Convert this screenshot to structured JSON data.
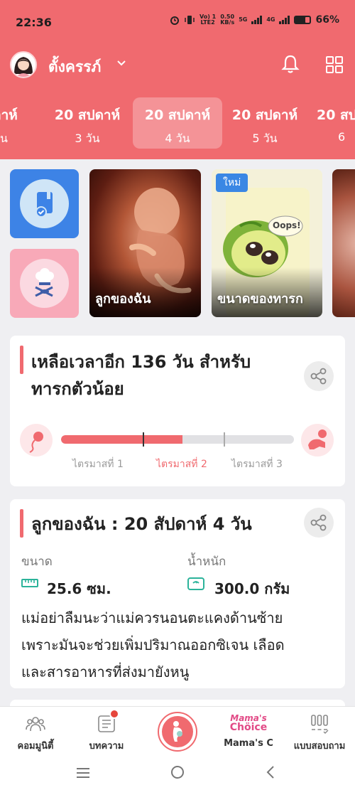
{
  "status_bar": {
    "time": "22:36",
    "net_line1": "Vo) 1",
    "net_line2": "LTE2",
    "speed_line1": "0.50",
    "speed_line2": "KB/s",
    "net_5g": "5G",
    "net_4g": "4G",
    "battery": "66%"
  },
  "header": {
    "username": "ตั้งครรภ์",
    "weeks": [
      {
        "week": "ปดาห์",
        "days": "วัน"
      },
      {
        "week": "20 สปดาห์",
        "days": "3 วัน"
      },
      {
        "week": "20 สปดาห์",
        "days": "4 วัน"
      },
      {
        "week": "20 สปดาห์",
        "days": "5 วัน"
      },
      {
        "week": "20 สป",
        "days": "6"
      }
    ]
  },
  "tiles": {
    "card_fetus_label": "ลูกของฉัน",
    "card_size_label": "ขนาดของทารก",
    "card_size_badge": "ใหม่",
    "oops_text": "Oops!"
  },
  "countdown": {
    "title_line1": "เหลือเวลาอีก 136 วัน สำหรับ",
    "title_line2": "ทารกตัวน้อย",
    "progress": 0.52,
    "trimesters": [
      "ไตรมาสที่ 1",
      "ไตรมาสที่ 2",
      "ไตรมาสที่ 3"
    ],
    "active_trimester": 2
  },
  "baby": {
    "title": "ลูกของฉัน : 20 สัปดาห์ 4  วัน",
    "size_label": "ขนาด",
    "size_value": "25.6 ซม.",
    "weight_label": "น้ำหนัก",
    "weight_value": "300.0 กรัม",
    "body_line1": "แม่อย่าลืมนะว่าแม่ควรนอนตะแคงด้านซ้าย",
    "body_line2": "เพราะมันจะช่วยเพิ่มปริมาณออกซิเจน เลือด",
    "body_line3": "และสารอาหารที่ส่งมายังหนู"
  },
  "bottom_nav": {
    "community": "คอมมูนิตี้",
    "articles": "บทความ",
    "mamas_logo_1": "Mama's",
    "mamas_logo_2": "Chöice",
    "mamas": "Mama's C",
    "survey": "แบบสอบถาม"
  },
  "colors": {
    "brand": "#f06a6f",
    "blue": "#3d83e6",
    "pink_tile": "#f8a9b8"
  }
}
